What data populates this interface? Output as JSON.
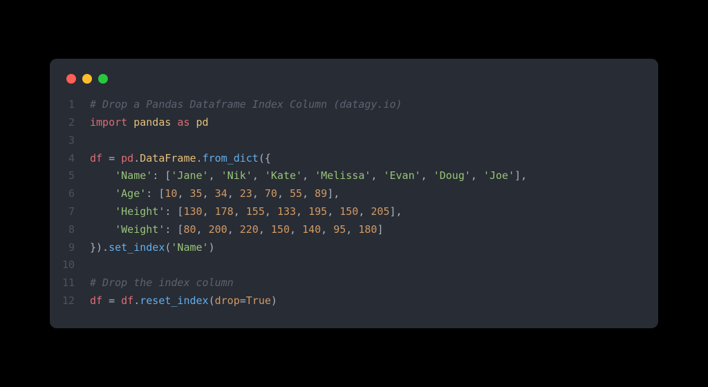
{
  "window": {
    "dots": [
      "red",
      "yellow",
      "green"
    ]
  },
  "code": {
    "lines": [
      {
        "n": "1",
        "tokens": [
          {
            "t": "# Drop a Pandas Dataframe Index Column (datagy.io)",
            "c": "c-comment"
          }
        ]
      },
      {
        "n": "2",
        "tokens": [
          {
            "t": "import",
            "c": "c-import"
          },
          {
            "t": " "
          },
          {
            "t": "pandas",
            "c": "c-var"
          },
          {
            "t": " "
          },
          {
            "t": "as",
            "c": "c-import"
          },
          {
            "t": " "
          },
          {
            "t": "pd",
            "c": "c-var"
          }
        ]
      },
      {
        "n": "3",
        "tokens": [
          {
            "t": ""
          }
        ]
      },
      {
        "n": "4",
        "tokens": [
          {
            "t": "df ",
            "c": "c-obj"
          },
          {
            "t": "= ",
            "c": "c-punct"
          },
          {
            "t": "pd",
            "c": "c-obj"
          },
          {
            "t": ".",
            "c": "c-punct"
          },
          {
            "t": "DataFrame",
            "c": "c-var"
          },
          {
            "t": ".",
            "c": "c-punct"
          },
          {
            "t": "from_dict",
            "c": "c-func"
          },
          {
            "t": "({",
            "c": "c-punct"
          }
        ]
      },
      {
        "n": "5",
        "tokens": [
          {
            "t": "    "
          },
          {
            "t": "'Name'",
            "c": "c-string"
          },
          {
            "t": ": [",
            "c": "c-punct"
          },
          {
            "t": "'Jane'",
            "c": "c-string"
          },
          {
            "t": ", ",
            "c": "c-punct"
          },
          {
            "t": "'Nik'",
            "c": "c-string"
          },
          {
            "t": ", ",
            "c": "c-punct"
          },
          {
            "t": "'Kate'",
            "c": "c-string"
          },
          {
            "t": ", ",
            "c": "c-punct"
          },
          {
            "t": "'Melissa'",
            "c": "c-string"
          },
          {
            "t": ", ",
            "c": "c-punct"
          },
          {
            "t": "'Evan'",
            "c": "c-string"
          },
          {
            "t": ", ",
            "c": "c-punct"
          },
          {
            "t": "'Doug'",
            "c": "c-string"
          },
          {
            "t": ", ",
            "c": "c-punct"
          },
          {
            "t": "'Joe'",
            "c": "c-string"
          },
          {
            "t": "],",
            "c": "c-punct"
          }
        ]
      },
      {
        "n": "6",
        "tokens": [
          {
            "t": "    "
          },
          {
            "t": "'Age'",
            "c": "c-string"
          },
          {
            "t": ": [",
            "c": "c-punct"
          },
          {
            "t": "10",
            "c": "c-num"
          },
          {
            "t": ", ",
            "c": "c-punct"
          },
          {
            "t": "35",
            "c": "c-num"
          },
          {
            "t": ", ",
            "c": "c-punct"
          },
          {
            "t": "34",
            "c": "c-num"
          },
          {
            "t": ", ",
            "c": "c-punct"
          },
          {
            "t": "23",
            "c": "c-num"
          },
          {
            "t": ", ",
            "c": "c-punct"
          },
          {
            "t": "70",
            "c": "c-num"
          },
          {
            "t": ", ",
            "c": "c-punct"
          },
          {
            "t": "55",
            "c": "c-num"
          },
          {
            "t": ", ",
            "c": "c-punct"
          },
          {
            "t": "89",
            "c": "c-num"
          },
          {
            "t": "],",
            "c": "c-punct"
          }
        ]
      },
      {
        "n": "7",
        "tokens": [
          {
            "t": "    "
          },
          {
            "t": "'Height'",
            "c": "c-string"
          },
          {
            "t": ": [",
            "c": "c-punct"
          },
          {
            "t": "130",
            "c": "c-num"
          },
          {
            "t": ", ",
            "c": "c-punct"
          },
          {
            "t": "178",
            "c": "c-num"
          },
          {
            "t": ", ",
            "c": "c-punct"
          },
          {
            "t": "155",
            "c": "c-num"
          },
          {
            "t": ", ",
            "c": "c-punct"
          },
          {
            "t": "133",
            "c": "c-num"
          },
          {
            "t": ", ",
            "c": "c-punct"
          },
          {
            "t": "195",
            "c": "c-num"
          },
          {
            "t": ", ",
            "c": "c-punct"
          },
          {
            "t": "150",
            "c": "c-num"
          },
          {
            "t": ", ",
            "c": "c-punct"
          },
          {
            "t": "205",
            "c": "c-num"
          },
          {
            "t": "],",
            "c": "c-punct"
          }
        ]
      },
      {
        "n": "8",
        "tokens": [
          {
            "t": "    "
          },
          {
            "t": "'Weight'",
            "c": "c-string"
          },
          {
            "t": ": [",
            "c": "c-punct"
          },
          {
            "t": "80",
            "c": "c-num"
          },
          {
            "t": ", ",
            "c": "c-punct"
          },
          {
            "t": "200",
            "c": "c-num"
          },
          {
            "t": ", ",
            "c": "c-punct"
          },
          {
            "t": "220",
            "c": "c-num"
          },
          {
            "t": ", ",
            "c": "c-punct"
          },
          {
            "t": "150",
            "c": "c-num"
          },
          {
            "t": ", ",
            "c": "c-punct"
          },
          {
            "t": "140",
            "c": "c-num"
          },
          {
            "t": ", ",
            "c": "c-punct"
          },
          {
            "t": "95",
            "c": "c-num"
          },
          {
            "t": ", ",
            "c": "c-punct"
          },
          {
            "t": "180",
            "c": "c-num"
          },
          {
            "t": "]",
            "c": "c-punct"
          }
        ]
      },
      {
        "n": "9",
        "tokens": [
          {
            "t": "}).",
            "c": "c-punct"
          },
          {
            "t": "set_index",
            "c": "c-func"
          },
          {
            "t": "(",
            "c": "c-punct"
          },
          {
            "t": "'Name'",
            "c": "c-string"
          },
          {
            "t": ")",
            "c": "c-punct"
          }
        ]
      },
      {
        "n": "10",
        "tokens": [
          {
            "t": ""
          }
        ]
      },
      {
        "n": "11",
        "tokens": [
          {
            "t": "# Drop the index column",
            "c": "c-comment"
          }
        ]
      },
      {
        "n": "12",
        "tokens": [
          {
            "t": "df ",
            "c": "c-obj"
          },
          {
            "t": "= ",
            "c": "c-punct"
          },
          {
            "t": "df",
            "c": "c-obj"
          },
          {
            "t": ".",
            "c": "c-punct"
          },
          {
            "t": "reset_index",
            "c": "c-func"
          },
          {
            "t": "(",
            "c": "c-punct"
          },
          {
            "t": "drop",
            "c": "c-param"
          },
          {
            "t": "=",
            "c": "c-punct"
          },
          {
            "t": "True",
            "c": "c-bool"
          },
          {
            "t": ")",
            "c": "c-punct"
          }
        ]
      }
    ]
  }
}
